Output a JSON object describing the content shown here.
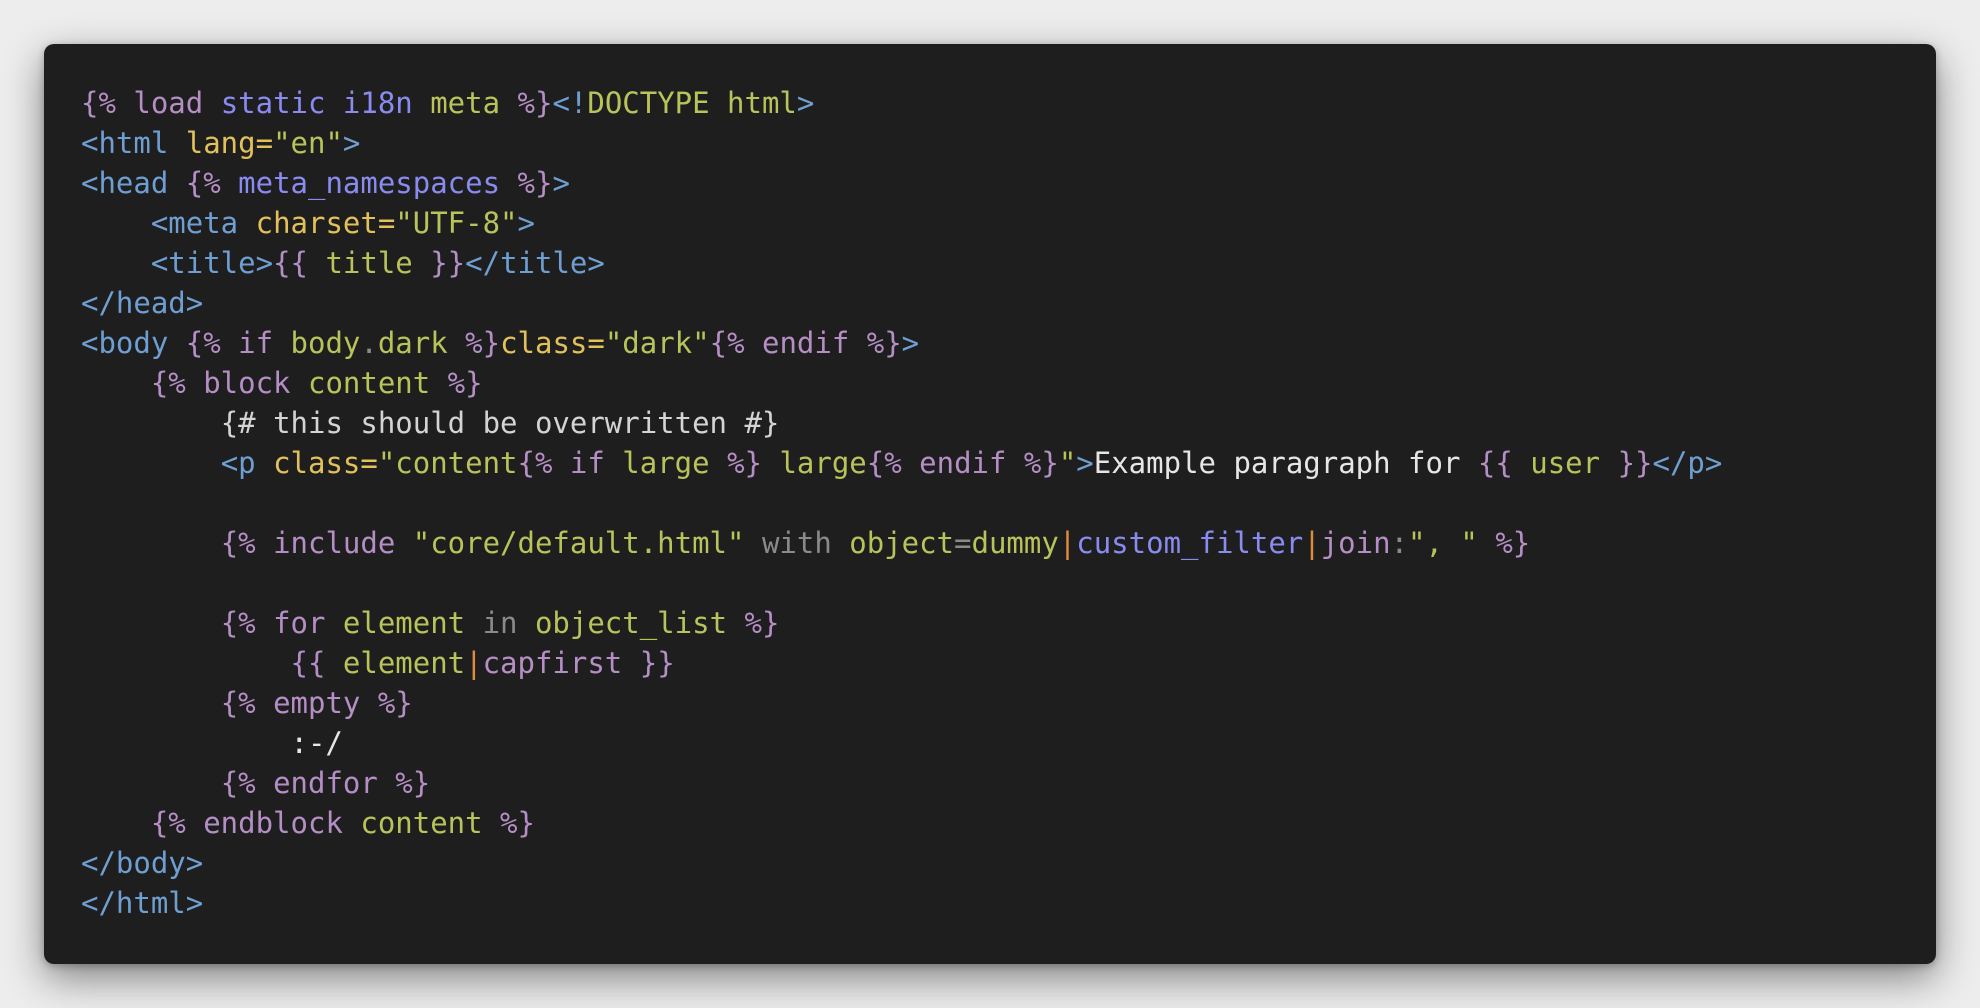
{
  "colors": {
    "background": "#ededed",
    "editor_background": "#1e1e1e",
    "template_tag": "#b58ec5",
    "keyword_blue": "#8a8bf0",
    "variable_green": "#b8c35a",
    "html_tag": "#6f9fd2",
    "attribute": "#e2c15a",
    "string": "#b8c35a",
    "comment": "#d4d4d4",
    "plain": "#e6e6e6",
    "muted": "#8a8a8a",
    "pipe": "#e08a3c"
  },
  "code": {
    "lines": [
      [
        {
          "t": "{% load ",
          "c": "template_tag"
        },
        {
          "t": "static i18n",
          "c": "keyword_blue"
        },
        {
          "t": " ",
          "c": "plain"
        },
        {
          "t": "meta",
          "c": "variable_green"
        },
        {
          "t": " %}",
          "c": "template_tag"
        },
        {
          "t": "<!",
          "c": "html_tag"
        },
        {
          "t": "DOCTYPE",
          "c": "variable_green"
        },
        {
          "t": " html",
          "c": "variable_green"
        },
        {
          "t": ">",
          "c": "html_tag"
        }
      ],
      [
        {
          "t": "<html ",
          "c": "html_tag"
        },
        {
          "t": "lang=",
          "c": "attribute"
        },
        {
          "t": "\"en\"",
          "c": "string"
        },
        {
          "t": ">",
          "c": "html_tag"
        }
      ],
      [
        {
          "t": "<head ",
          "c": "html_tag"
        },
        {
          "t": "{% ",
          "c": "template_tag"
        },
        {
          "t": "meta_namespaces",
          "c": "keyword_blue"
        },
        {
          "t": " %}",
          "c": "template_tag"
        },
        {
          "t": ">",
          "c": "html_tag"
        }
      ],
      [
        {
          "t": "    ",
          "c": "plain"
        },
        {
          "t": "<meta ",
          "c": "html_tag"
        },
        {
          "t": "charset=",
          "c": "attribute"
        },
        {
          "t": "\"UTF-8\"",
          "c": "string"
        },
        {
          "t": ">",
          "c": "html_tag"
        }
      ],
      [
        {
          "t": "    ",
          "c": "plain"
        },
        {
          "t": "<title>",
          "c": "html_tag"
        },
        {
          "t": "{{ ",
          "c": "template_tag"
        },
        {
          "t": "title",
          "c": "variable_green"
        },
        {
          "t": " }}",
          "c": "template_tag"
        },
        {
          "t": "</title>",
          "c": "html_tag"
        }
      ],
      [
        {
          "t": "</head>",
          "c": "html_tag"
        }
      ],
      [
        {
          "t": "<body ",
          "c": "html_tag"
        },
        {
          "t": "{% if ",
          "c": "template_tag"
        },
        {
          "t": "body",
          "c": "variable_green"
        },
        {
          "t": ".",
          "c": "muted"
        },
        {
          "t": "dark",
          "c": "variable_green"
        },
        {
          "t": " %}",
          "c": "template_tag"
        },
        {
          "t": "class=",
          "c": "attribute"
        },
        {
          "t": "\"dark\"",
          "c": "string"
        },
        {
          "t": "{% endif %}",
          "c": "template_tag"
        },
        {
          "t": ">",
          "c": "html_tag"
        }
      ],
      [
        {
          "t": "    ",
          "c": "plain"
        },
        {
          "t": "{% block ",
          "c": "template_tag"
        },
        {
          "t": "content",
          "c": "variable_green"
        },
        {
          "t": " %}",
          "c": "template_tag"
        }
      ],
      [
        {
          "t": "        ",
          "c": "plain"
        },
        {
          "t": "{# this should be overwritten #}",
          "c": "comment"
        }
      ],
      [
        {
          "t": "        ",
          "c": "plain"
        },
        {
          "t": "<p ",
          "c": "html_tag"
        },
        {
          "t": "class=",
          "c": "attribute"
        },
        {
          "t": "\"content",
          "c": "string"
        },
        {
          "t": "{% if ",
          "c": "template_tag"
        },
        {
          "t": "large",
          "c": "variable_green"
        },
        {
          "t": " %}",
          "c": "template_tag"
        },
        {
          "t": " large",
          "c": "string"
        },
        {
          "t": "{% endif %}",
          "c": "template_tag"
        },
        {
          "t": "\"",
          "c": "string"
        },
        {
          "t": ">",
          "c": "html_tag"
        },
        {
          "t": "Example paragraph for ",
          "c": "plain"
        },
        {
          "t": "{{ ",
          "c": "template_tag"
        },
        {
          "t": "user",
          "c": "variable_green"
        },
        {
          "t": " }}",
          "c": "template_tag"
        },
        {
          "t": "</p>",
          "c": "html_tag"
        }
      ],
      [],
      [
        {
          "t": "        ",
          "c": "plain"
        },
        {
          "t": "{% include ",
          "c": "template_tag"
        },
        {
          "t": "\"core/default.html\"",
          "c": "string"
        },
        {
          "t": " with ",
          "c": "muted"
        },
        {
          "t": "object",
          "c": "variable_green"
        },
        {
          "t": "=",
          "c": "muted"
        },
        {
          "t": "dummy",
          "c": "variable_green"
        },
        {
          "t": "|",
          "c": "pipe"
        },
        {
          "t": "custom_filter",
          "c": "keyword_blue"
        },
        {
          "t": "|",
          "c": "pipe"
        },
        {
          "t": "join",
          "c": "template_tag"
        },
        {
          "t": ":",
          "c": "muted"
        },
        {
          "t": "\", \"",
          "c": "string"
        },
        {
          "t": " %}",
          "c": "template_tag"
        }
      ],
      [],
      [
        {
          "t": "        ",
          "c": "plain"
        },
        {
          "t": "{% for ",
          "c": "template_tag"
        },
        {
          "t": "element",
          "c": "variable_green"
        },
        {
          "t": " in ",
          "c": "muted"
        },
        {
          "t": "object_list",
          "c": "variable_green"
        },
        {
          "t": " %}",
          "c": "template_tag"
        }
      ],
      [
        {
          "t": "            ",
          "c": "plain"
        },
        {
          "t": "{{ ",
          "c": "template_tag"
        },
        {
          "t": "element",
          "c": "variable_green"
        },
        {
          "t": "|",
          "c": "pipe"
        },
        {
          "t": "capfirst",
          "c": "template_tag"
        },
        {
          "t": " }}",
          "c": "template_tag"
        }
      ],
      [
        {
          "t": "        ",
          "c": "plain"
        },
        {
          "t": "{% empty %}",
          "c": "template_tag"
        }
      ],
      [
        {
          "t": "            ",
          "c": "plain"
        },
        {
          "t": ":-/",
          "c": "plain"
        }
      ],
      [
        {
          "t": "        ",
          "c": "plain"
        },
        {
          "t": "{% endfor %}",
          "c": "template_tag"
        }
      ],
      [
        {
          "t": "    ",
          "c": "plain"
        },
        {
          "t": "{% endblock ",
          "c": "template_tag"
        },
        {
          "t": "content",
          "c": "variable_green"
        },
        {
          "t": " %}",
          "c": "template_tag"
        }
      ],
      [
        {
          "t": "</body>",
          "c": "html_tag"
        }
      ],
      [
        {
          "t": "</html>",
          "c": "html_tag"
        }
      ]
    ]
  }
}
